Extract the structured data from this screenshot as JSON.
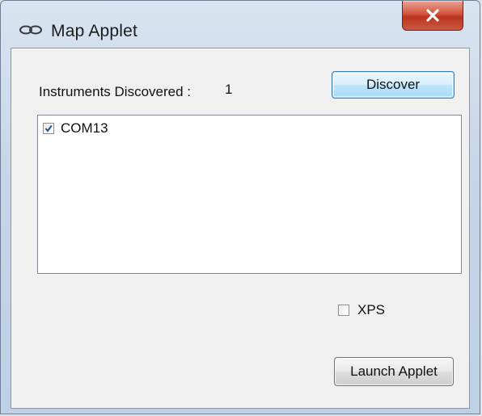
{
  "window": {
    "title": "Map Applet",
    "icon": "link-chain-icon"
  },
  "close_button": {
    "icon": "close-x-icon"
  },
  "instruments": {
    "label": "Instruments Discovered :",
    "count": "1"
  },
  "buttons": {
    "discover_label": "Discover",
    "launch_label": "Launch Applet"
  },
  "instrument_list": [
    {
      "label": "COM13",
      "checked": true
    }
  ],
  "options": {
    "xps_label": "XPS",
    "xps_checked": false
  },
  "colors": {
    "titlebar": "#c7d6e8",
    "close_button": "#c8462f",
    "client_background": "#f0f0f0",
    "list_background": "#ffffff",
    "discover_highlight": "#bee6fd"
  }
}
